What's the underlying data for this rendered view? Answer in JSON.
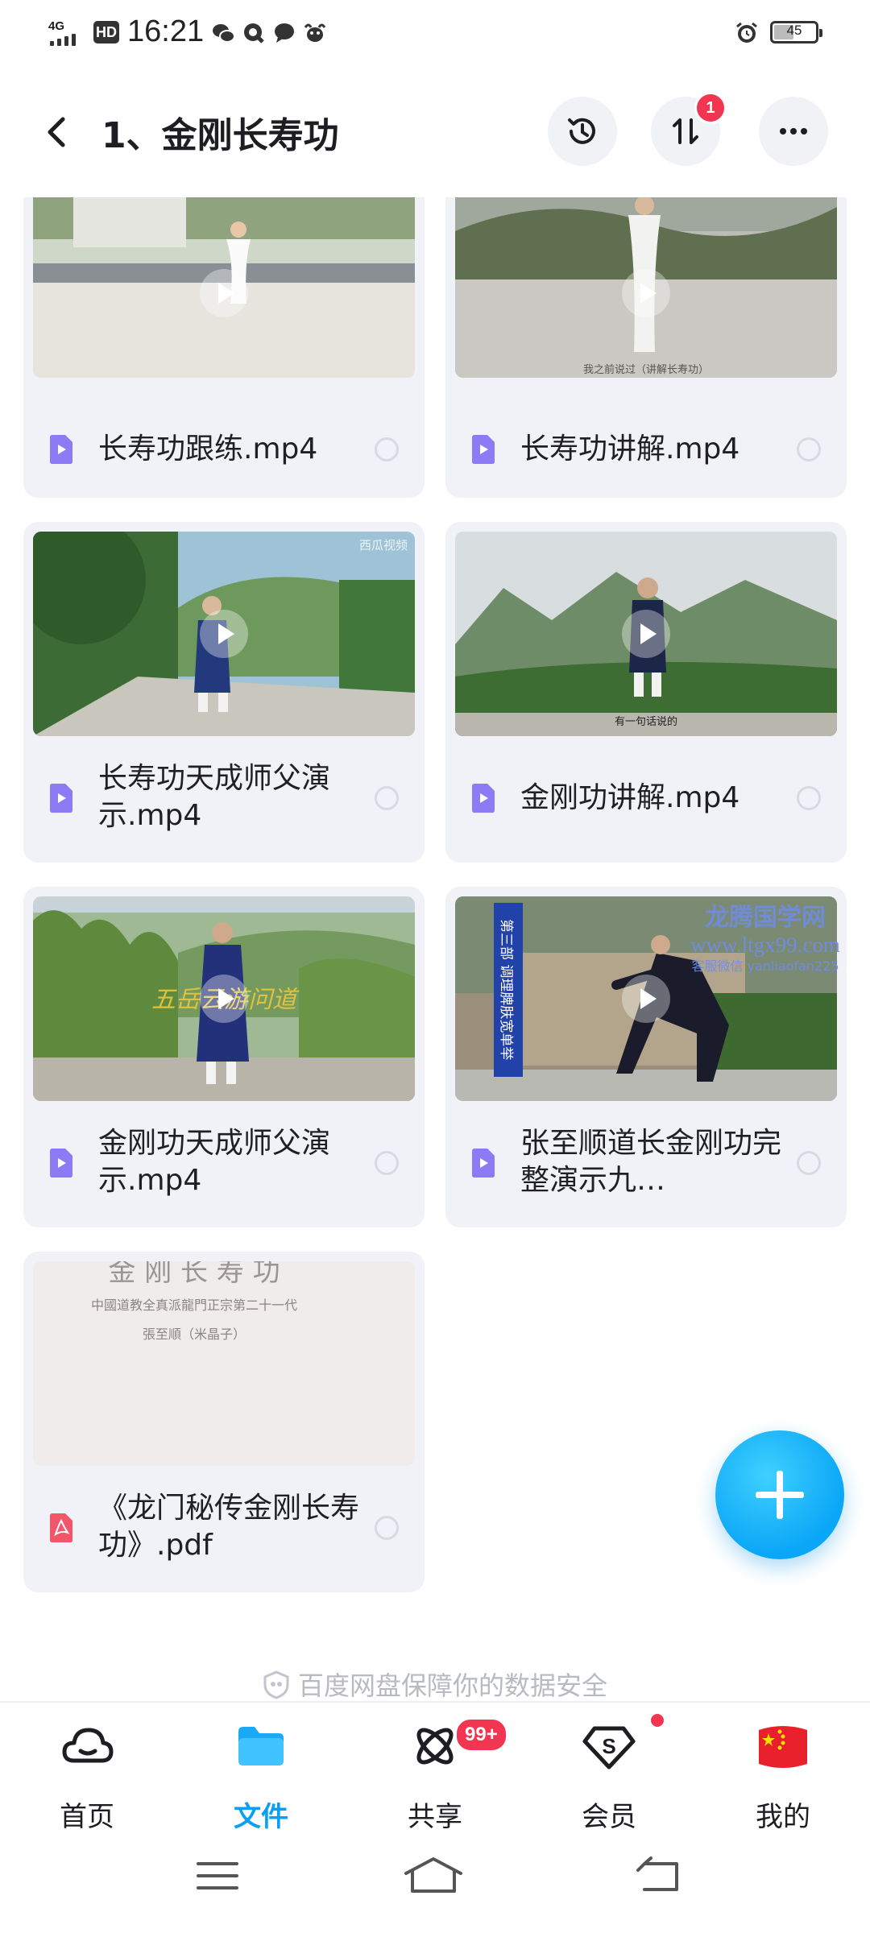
{
  "status_bar": {
    "network": "4G",
    "hd": "HD",
    "time": "16:21",
    "battery": "45",
    "battery_level": 0.45,
    "app_icons": [
      "wechat-icon",
      "quark-icon",
      "message-icon",
      "cow-icon"
    ],
    "alarm_icon": "alarm-icon"
  },
  "header": {
    "title": "1、金刚长寿功",
    "sort_badge": "1"
  },
  "files": [
    {
      "name": "长寿功跟练.mp4",
      "type": "video"
    },
    {
      "name": "长寿功讲解.mp4",
      "type": "video",
      "overlay_text": "我之前说过（讲解长寿功）"
    },
    {
      "name": "长寿功天成师父演示.mp4",
      "type": "video",
      "watermark": "西瓜视频"
    },
    {
      "name": "金刚功讲解.mp4",
      "type": "video",
      "overlay_text": "有一句话说的"
    },
    {
      "name": "金刚功天成师父演示.mp4",
      "type": "video",
      "overlay_text": "五岳云游问道"
    },
    {
      "name": "张至顺道长金刚功完整演示九…",
      "type": "video",
      "banner": "第三部 调理脾肤宽单举",
      "watermark_lines": [
        "龙腾国学网",
        "www.ltgx99.com",
        "客服微信 yanliaofan225"
      ]
    },
    {
      "name": "《龙门秘传金刚长寿功》.pdf",
      "type": "pdf",
      "doc_lines": [
        "金 刚 长 寿 功",
        "中國道教全真派龍門正宗第二十一代",
        "張至順（米晶子）"
      ]
    }
  ],
  "safety_note": "百度网盘保障你的数据安全",
  "bottom_nav": [
    {
      "label": "首页",
      "icon": "cloud-home-icon"
    },
    {
      "label": "文件",
      "icon": "folder-icon",
      "active": true
    },
    {
      "label": "共享",
      "icon": "share-atom-icon",
      "badge": "99+"
    },
    {
      "label": "会员",
      "icon": "vip-diamond-icon",
      "dot": true
    },
    {
      "label": "我的",
      "icon": "china-flag-avatar-icon"
    }
  ],
  "colors": {
    "accent": "#08a0f5",
    "badge": "#f23652",
    "card": "#f1f2f8",
    "video_icon": "#8b7cf6",
    "pdf_icon": "#f2566a"
  }
}
